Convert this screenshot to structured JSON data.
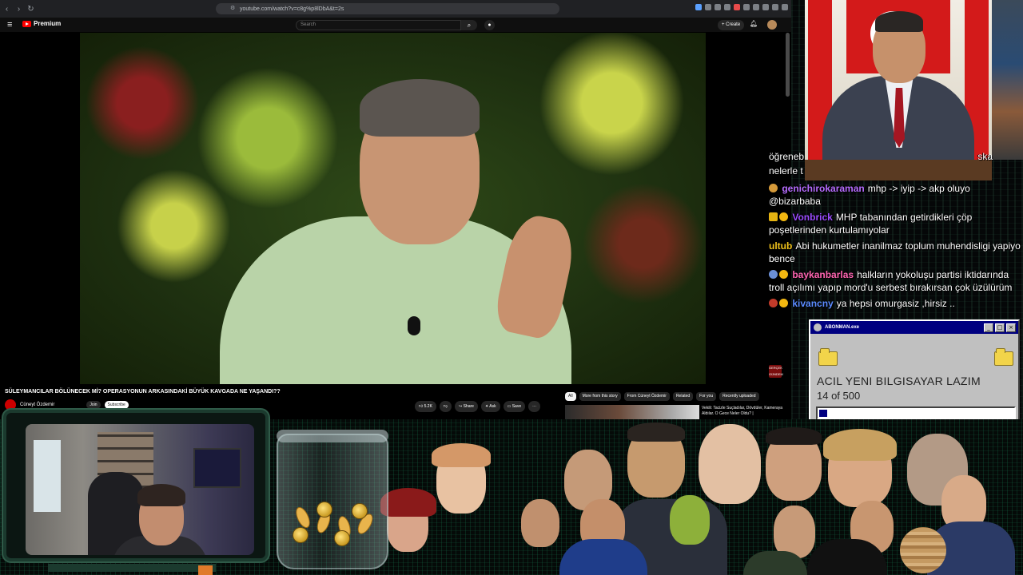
{
  "browser": {
    "url": "youtube.com/watch?v=c8g%p8lDbA&t=2s"
  },
  "youtube": {
    "logo_text": "Premium",
    "search_placeholder": "Search",
    "create_label": "+ Create",
    "video_title": "SÜLEYMANCILAR BÖLÜNECEK Mİ? OPERASYONUN ARKASINDAKİ BÜYÜK KAVGADA NE YAŞANDI??",
    "channel_name": "Cüneyt Özdemir",
    "join_label": "Join",
    "subscribe_label": "Subscribe",
    "actions": {
      "like_count": "5.2K",
      "share_label": "Share",
      "ask_label": "Ask",
      "save_label": "Save",
      "more_label": "···"
    },
    "chips": [
      "All",
      "More from this story",
      "From Cüneyt Özdemir",
      "Related",
      "For you",
      "Recently uploaded"
    ],
    "recommendation_title": "Vekili: Tacizle Suçladılar, Dövdüler, Kameraya Aldılar. O Gece Neler Oldu? |"
  },
  "chat": {
    "truncated_top": "öğreneb",
    "truncated_top_2": "nelerle t",
    "truncated_right": "ska",
    "messages": [
      {
        "name": "genichirokaraman",
        "color": "#b66cff",
        "message": "mhp -> iyip -> akp oluyo @bizarbaba"
      },
      {
        "name": "Vonbrick",
        "color": "#9b4dff",
        "message": "MHP tabanından getirdikleri çöp poşetlerinden kurtulamıyolar"
      },
      {
        "name": "ultub",
        "color": "#f0c21b",
        "message": "Abi hukumetler inanilmaz toplum muhendisligi yapiyo bence"
      },
      {
        "name": "baykanbarlas",
        "color": "#ff66b2",
        "message": "halkların yokoluşu partisi iktidarında troll açılımı yapıp mord'u serbest bırakırsan çok üzülürüm"
      },
      {
        "name": "kivancny",
        "color": "#5b8cff",
        "message": "ya hepsi omurgasiz ,hirsiz .."
      }
    ]
  },
  "donation_window": {
    "title": "ABONMAN.exe",
    "headline": "ACIL YENI BILGISAYAR LAZIM",
    "count_text": "14 of 500",
    "progress_fraction": 0.028
  },
  "overlay": {
    "channel_badge": "GERÇEK GÜNDEM"
  },
  "colors": {
    "youtube_red": "#ff0000",
    "win_title_blue": "#000080",
    "overlay_green": "#1b3a2e"
  }
}
